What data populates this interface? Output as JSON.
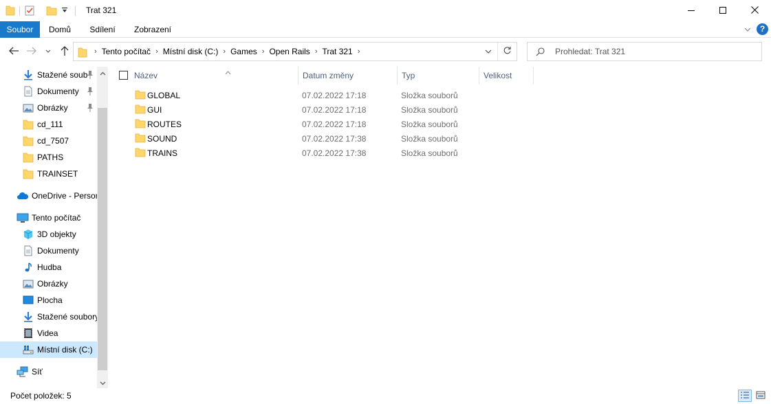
{
  "window": {
    "title": "Trat 321",
    "controls": {
      "minimize": "minimize",
      "maximize": "maximize",
      "close": "close"
    }
  },
  "ribbon": {
    "tabs": [
      {
        "label": "Soubor",
        "active": true
      },
      {
        "label": "Domů"
      },
      {
        "label": "Sdílení"
      },
      {
        "label": "Zobrazení"
      }
    ],
    "help": "?"
  },
  "navigation": {
    "breadcrumb": [
      "Tento počítač",
      "Místní disk (C:)",
      "Games",
      "Open Rails",
      "Trat 321"
    ],
    "search_placeholder": "Prohledat: Trat 321"
  },
  "sidebar": {
    "items": [
      {
        "label": "Stažené soub",
        "icon": "download-icon",
        "pinned": true
      },
      {
        "label": "Dokumenty",
        "icon": "documents-icon",
        "pinned": true
      },
      {
        "label": "Obrázky",
        "icon": "pictures-icon",
        "pinned": true
      },
      {
        "label": "cd_111",
        "icon": "folder-icon"
      },
      {
        "label": "cd_7507",
        "icon": "folder-icon"
      },
      {
        "label": "PATHS",
        "icon": "folder-icon"
      },
      {
        "label": "TRAINSET",
        "icon": "folder-icon"
      },
      {
        "label": "OneDrive - Persor",
        "icon": "onedrive-icon"
      },
      {
        "label": "Tento počítač",
        "icon": "computer-icon"
      },
      {
        "label": "3D objekty",
        "icon": "3d-objects-icon"
      },
      {
        "label": "Dokumenty",
        "icon": "documents-icon"
      },
      {
        "label": "Hudba",
        "icon": "music-icon"
      },
      {
        "label": "Obrázky",
        "icon": "pictures-icon"
      },
      {
        "label": "Plocha",
        "icon": "desktop-icon"
      },
      {
        "label": "Stažené soubory",
        "icon": "download-icon"
      },
      {
        "label": "Videa",
        "icon": "videos-icon"
      },
      {
        "label": "Místní disk (C:)",
        "icon": "drive-icon",
        "selected": true
      },
      {
        "label": "Síť",
        "icon": "network-icon"
      }
    ]
  },
  "filelist": {
    "columns": {
      "name": "Název",
      "date": "Datum změny",
      "type": "Typ",
      "size": "Velikost"
    },
    "rows": [
      {
        "name": "GLOBAL",
        "date": "07.02.2022 17:18",
        "type": "Složka souborů"
      },
      {
        "name": "GUI",
        "date": "07.02.2022 17:18",
        "type": "Složka souborů"
      },
      {
        "name": "ROUTES",
        "date": "07.02.2022 17:18",
        "type": "Složka souborů"
      },
      {
        "name": "SOUND",
        "date": "07.02.2022 17:38",
        "type": "Složka souborů"
      },
      {
        "name": "TRAINS",
        "date": "07.02.2022 17:38",
        "type": "Složka souborů"
      }
    ]
  },
  "status": {
    "item_count": "Počet položek: 5"
  },
  "colors": {
    "accent": "#1979ca",
    "selection": "#cce8ff",
    "folder": "#ffd66b",
    "header_text": "#4c607a",
    "muted_text": "#6d6d6d"
  }
}
